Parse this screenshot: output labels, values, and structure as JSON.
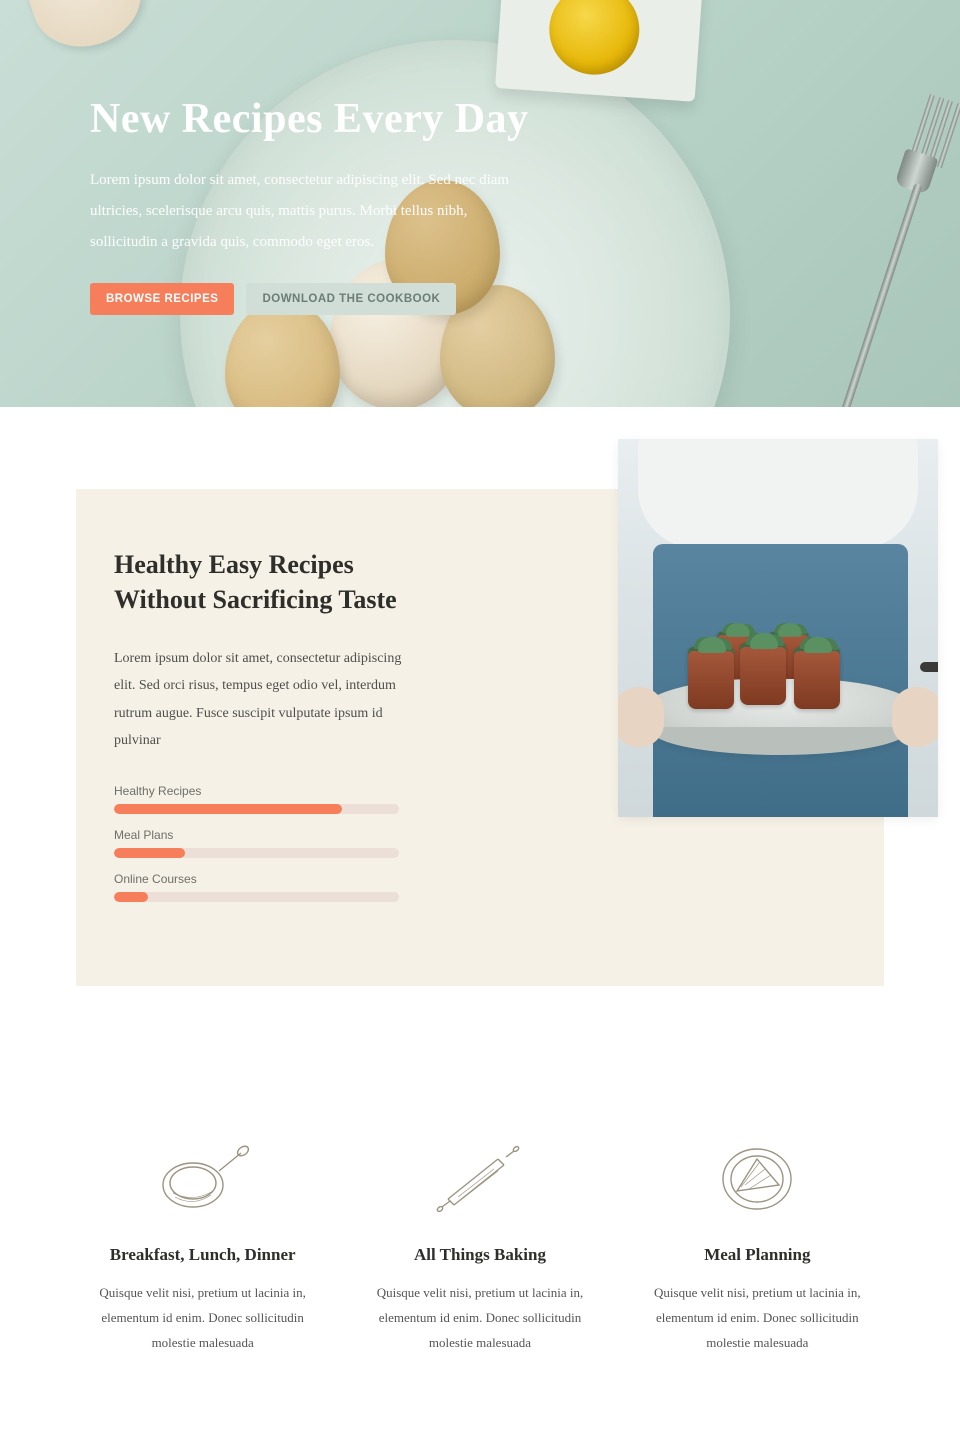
{
  "hero": {
    "title": "New Recipes Every Day",
    "description": "Lorem ipsum dolor sit amet, consectetur adipiscing elit. Sed nec diam ultricies, scelerisque arcu quis, mattis purus. Morbi tellus nibh, sollicitudin a gravida quis, commodo eget eros.",
    "primary_button": "BROWSE RECIPES",
    "secondary_button": "DOWNLOAD THE COOKBOOK"
  },
  "intro": {
    "title": "Healthy Easy Recipes Without Sacrificing Taste",
    "description": "Lorem ipsum dolor sit amet, consectetur adipiscing elit. Sed orci risus, tempus eget odio vel, interdum rutrum augue. Fusce suscipit vulputate ipsum id pulvinar",
    "bars": [
      {
        "label": "Healthy Recipes",
        "percent": 80
      },
      {
        "label": "Meal Plans",
        "percent": 25
      },
      {
        "label": "Online Courses",
        "percent": 12
      }
    ]
  },
  "features": [
    {
      "title": "Breakfast, Lunch, Dinner",
      "description": "Quisque velit nisi, pretium ut lacinia in, elementum id enim. Donec sollicitudin molestie malesuada"
    },
    {
      "title": "All Things Baking",
      "description": "Quisque velit nisi, pretium ut lacinia in, elementum id enim. Donec sollicitudin molestie malesuada"
    },
    {
      "title": "Meal Planning",
      "description": "Quisque velit nisi, pretium ut lacinia in, elementum id enim. Donec sollicitudin molestie malesuada"
    }
  ]
}
